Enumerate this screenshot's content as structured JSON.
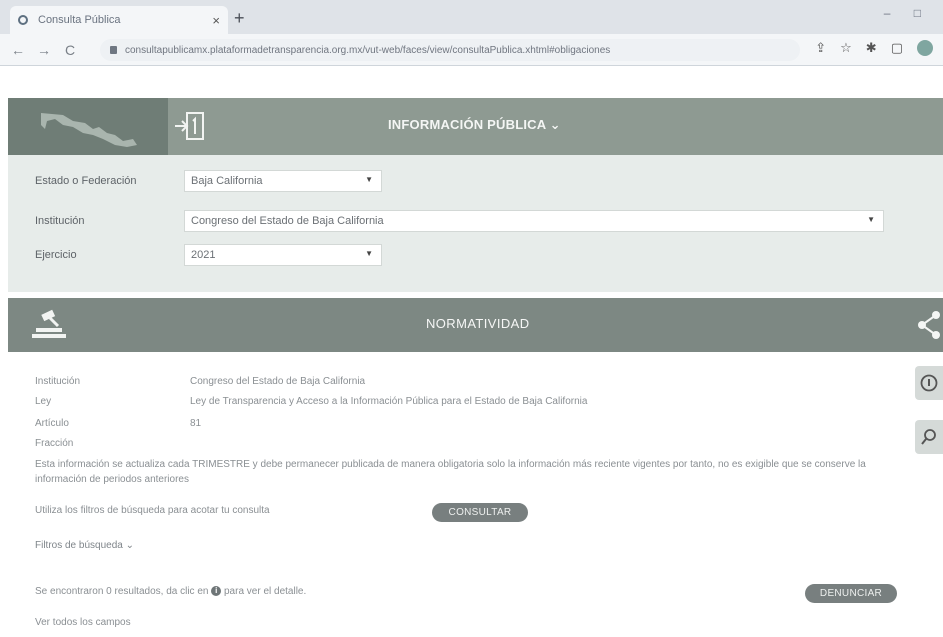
{
  "browser": {
    "tab_title": "Consulta Pública",
    "tab_close": "×",
    "new_tab": "+",
    "window_controls": "‒ □",
    "nav_back": "←",
    "nav_forward": "→",
    "nav_reload": "C",
    "url": "consultapublicamx.plataformadetransparencia.org.mx/vut-web/faces/view/consultaPublica.xhtml#obligaciones"
  },
  "header": {
    "title": "INFORMACIÓN PÚBLICA ⌄"
  },
  "filters": {
    "estado_label": "Estado o Federación",
    "estado_value": "Baja California",
    "institucion_label": "Institución",
    "institucion_value": "Congreso del Estado de Baja California",
    "ejercicio_label": "Ejercicio",
    "ejercicio_value": "2021"
  },
  "section": {
    "title": "NORMATIVIDAD"
  },
  "details": {
    "institucion_label": "Institución",
    "institucion_value": "Congreso del Estado de Baja California",
    "ley_label": "Ley",
    "ley_value": "Ley de Transparencia y Acceso a la Información Pública para el Estado de Baja California",
    "articulo_label": "Artículo",
    "articulo_value": "81",
    "fraccion_label": "Fracción",
    "fraccion_value": "",
    "paragraph": "Esta información se actualiza cada TRIMESTRE y debe permanecer publicada de manera obligatoria solo la información más reciente vigentes por tanto, no es exigible que se conserve la información de periodos anteriores",
    "hint": "Utiliza los filtros de búsqueda para acotar tu consulta",
    "consultar_button": "CONSULTAR",
    "filtros_link": "Filtros de búsqueda ⌄",
    "results_pre": "Se encontraron 0 resultados, da clic en",
    "results_post": "para ver el detalle.",
    "denunciar_button": "DENUNCIAR",
    "ver_todos": "Ver todos los campos"
  }
}
